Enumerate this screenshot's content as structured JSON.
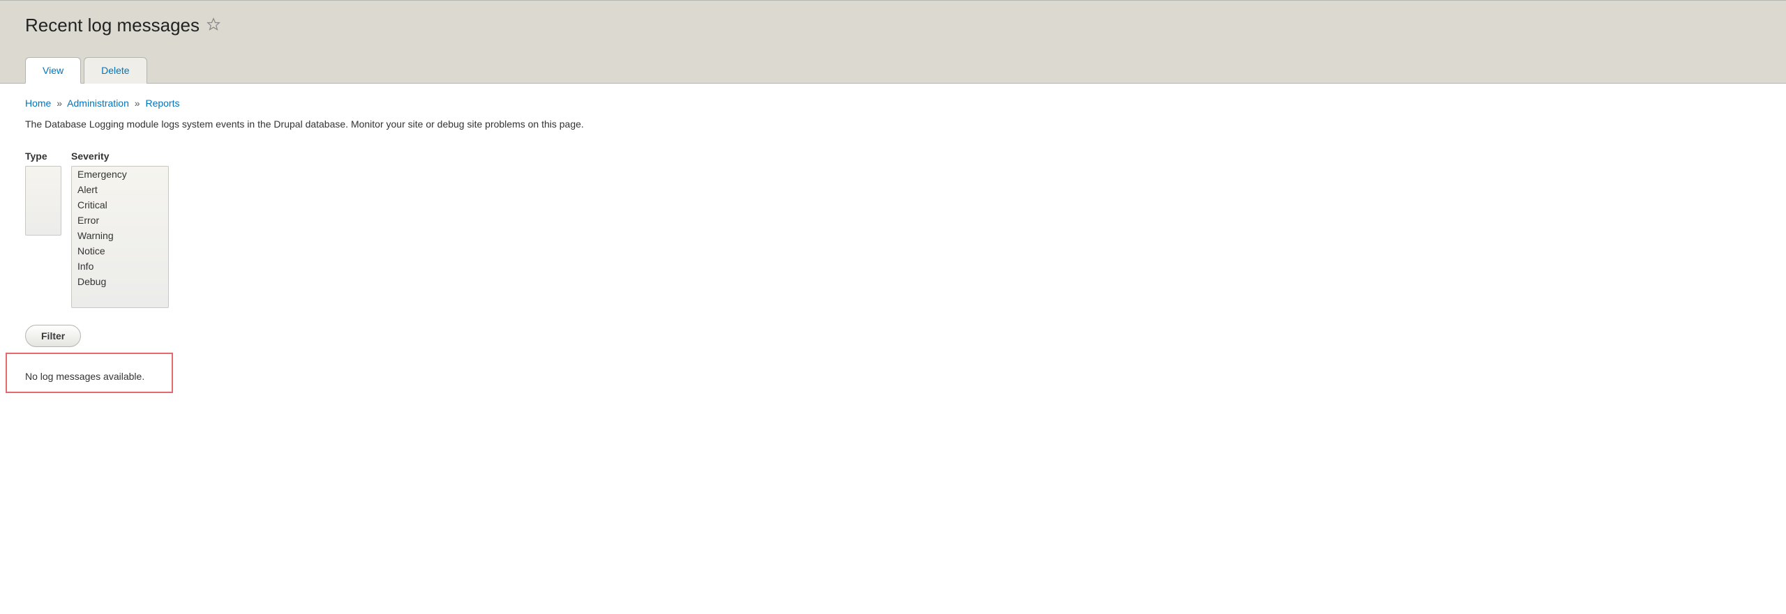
{
  "header": {
    "title": "Recent log messages"
  },
  "tabs": {
    "view": "View",
    "delete": "Delete"
  },
  "breadcrumb": {
    "home": "Home",
    "administration": "Administration",
    "reports": "Reports",
    "sep": "»"
  },
  "description": "The Database Logging module logs system events in the Drupal database. Monitor your site or debug site problems on this page.",
  "filters": {
    "type_label": "Type",
    "severity_label": "Severity",
    "severity_options": {
      "emergency": "Emergency",
      "alert": "Alert",
      "critical": "Critical",
      "error": "Error",
      "warning": "Warning",
      "notice": "Notice",
      "info": "Info",
      "debug": "Debug"
    },
    "button": "Filter"
  },
  "empty": "No log messages available."
}
